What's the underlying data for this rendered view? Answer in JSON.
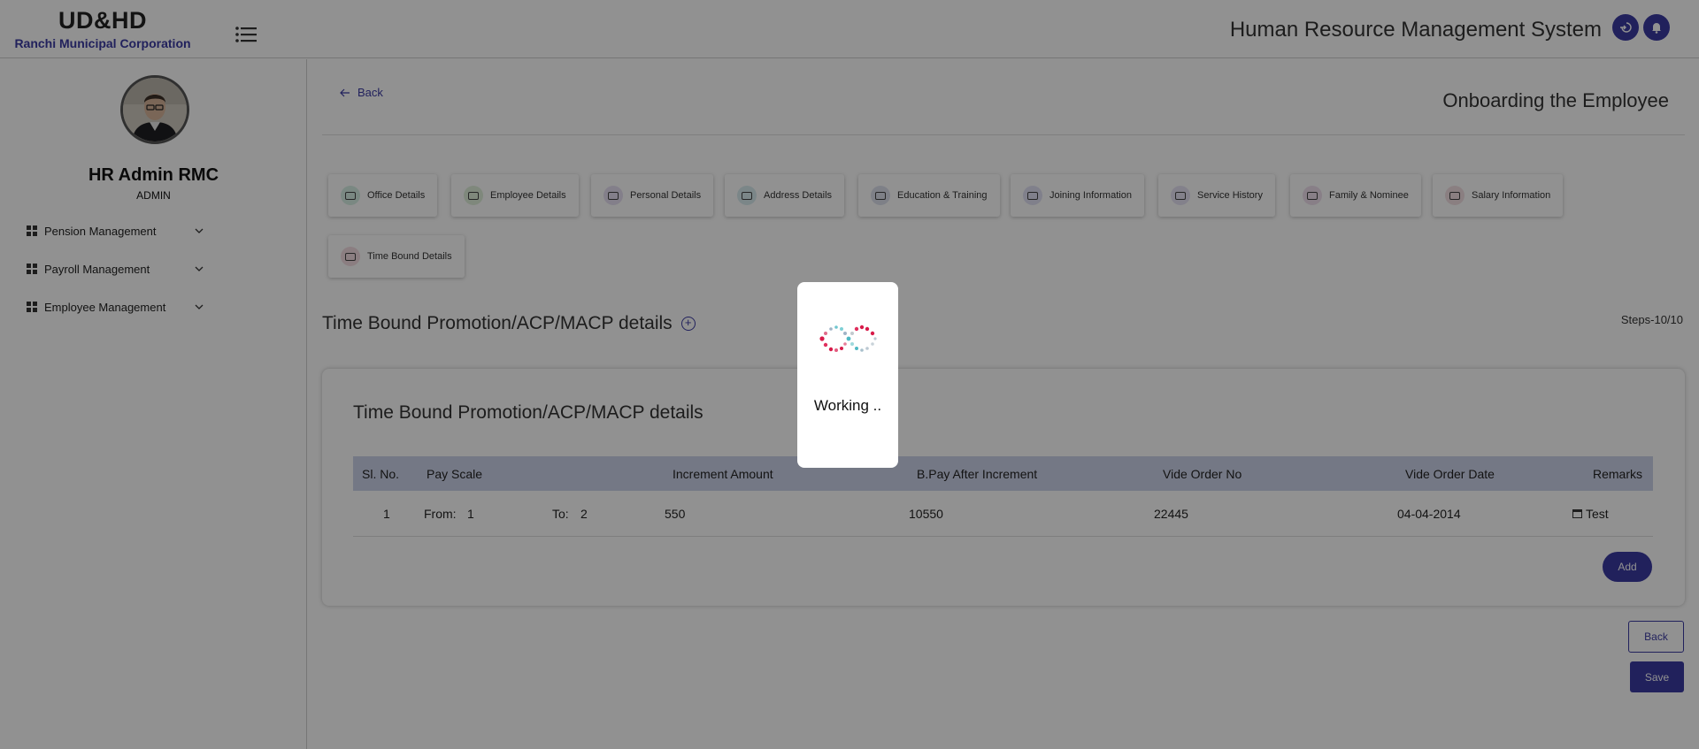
{
  "header": {
    "brand_title": "UD&HD",
    "brand_subtitle": "Ranchi Municipal Corporation",
    "app_title": "Human Resource Management System"
  },
  "sidebar": {
    "user_name": "HR Admin RMC",
    "user_role": "ADMIN",
    "items": [
      {
        "label": "Pension Management"
      },
      {
        "label": "Payroll Management"
      },
      {
        "label": "Employee Management"
      }
    ]
  },
  "main": {
    "back_label": "Back",
    "page_title": "Onboarding the Employee",
    "tabs": [
      {
        "label": "Office Details",
        "icon": "office-icon",
        "color": "#d7f0e4"
      },
      {
        "label": "Employee Details",
        "icon": "id-card-icon",
        "color": "#dff0da"
      },
      {
        "label": "Personal Details",
        "icon": "profile-icon",
        "color": "#e6e0f2"
      },
      {
        "label": "Address Details",
        "icon": "home-icon",
        "color": "#d8ecef"
      },
      {
        "label": "Education & Training",
        "icon": "school-icon",
        "color": "#dde1ee"
      },
      {
        "label": "Joining Information",
        "icon": "person-icon",
        "color": "#e2e2f4"
      },
      {
        "label": "Service History",
        "icon": "history-icon",
        "color": "#e7e3f4"
      },
      {
        "label": "Family & Nominee",
        "icon": "family-icon",
        "color": "#efe0ee"
      },
      {
        "label": "Salary Information",
        "icon": "salary-icon",
        "color": "#f2dfe3"
      },
      {
        "label": "Time Bound Details",
        "icon": "timer-icon",
        "color": "#f5dde3"
      }
    ],
    "section_heading": "Time Bound Promotion/ACP/MACP details",
    "steps": "Steps-10/10",
    "card_title": "Time Bound Promotion/ACP/MACP details",
    "table": {
      "headers": {
        "sl": "Sl. No.",
        "pay_scale": "Pay Scale",
        "increment": "Increment Amount",
        "bpay": "B.Pay After Increment",
        "vide_no": "Vide Order No",
        "vide_date": "Vide Order Date",
        "remarks": "Remarks"
      },
      "rows": [
        {
          "sl": "1",
          "from_label": "From:",
          "from_value": "1",
          "to_label": "To:",
          "to_value": "2",
          "increment": "550",
          "bpay": "10550",
          "vide_no": "22445",
          "vide_date": "04-04-2014",
          "remarks": "Test"
        }
      ]
    },
    "add_label": "Add",
    "back_button_label": "Back",
    "save_label": "Save"
  },
  "loader": {
    "text": "Working .."
  },
  "colors": {
    "accent": "#3b3aa3",
    "overlay": "rgba(0,0,0,0.43)"
  }
}
